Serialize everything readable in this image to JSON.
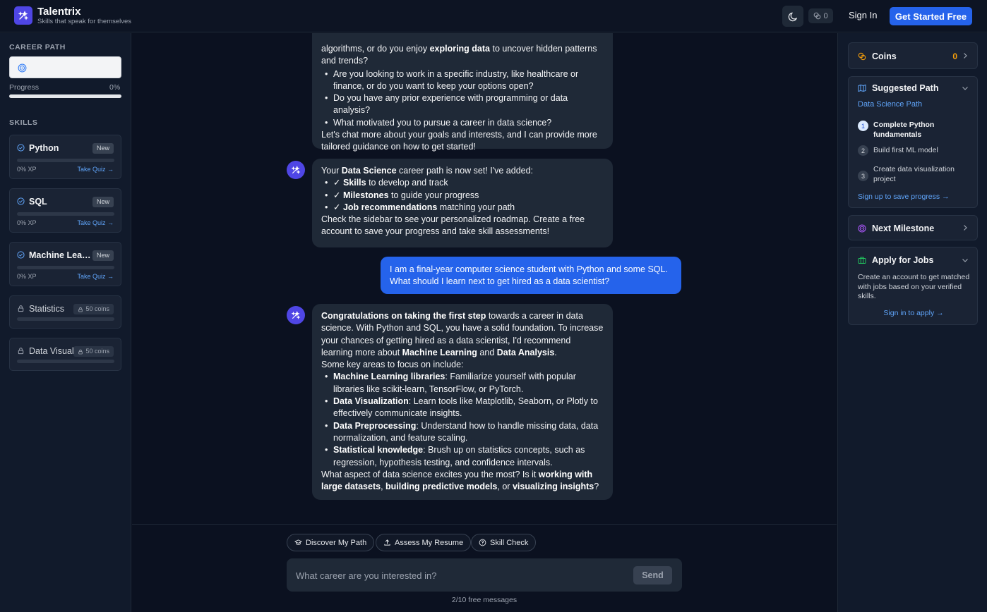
{
  "header": {
    "brand": "Talentrix",
    "tagline": "Skills that speak for themselves",
    "coin_count": "0",
    "signin_label": "Sign In",
    "get_started_label": "Get Started Free"
  },
  "left": {
    "career_path_label": "CAREER PATH",
    "progress_label": "Progress",
    "progress_value": "0%",
    "progress_fraction": 0.0,
    "skills_label": "SKILLS",
    "skills": [
      {
        "name": "Python",
        "badge": "New",
        "xp": "0% XP",
        "quiz": "Take Quiz →",
        "progress": 0.0
      },
      {
        "name": "SQL",
        "badge": "New",
        "xp": "0% XP",
        "quiz": "Take Quiz →",
        "progress": 0.0
      },
      {
        "name": "Machine Learning",
        "badge": "New",
        "xp": "0% XP",
        "quiz": "Take Quiz →",
        "progress": 0.0
      }
    ],
    "locked_skills": [
      {
        "name": "Statistics",
        "badge": "50 coins"
      },
      {
        "name": "Data Visualization",
        "badge": "50 coins"
      }
    ]
  },
  "chat": {
    "msg1": {
      "lead1": "algorithms, or do you enjoy ",
      "lead_bold": "exploring data",
      "lead2": " to uncover hidden patterns",
      "lead3": "and trends?",
      "bullets": [
        "Are you looking to work in a specific industry, like healthcare or finance, or do you want to keep your options open?",
        "Do you have any prior experience with programming or data analysis?",
        "What motivated you to pursue a career in data science?"
      ],
      "closing": "Let's chat more about your goals and interests, and I can provide more tailored guidance on how to get started!"
    },
    "msg2": {
      "intro_a": "Your ",
      "intro_bold": "Data Science",
      "intro_b": " career path is now set! I've added:",
      "items": [
        {
          "bold": "✓ Skills",
          "rest": " to develop and track"
        },
        {
          "bold": "✓ Milestones",
          "rest": " to guide your progress"
        },
        {
          "bold": "✓ Job recommendations",
          "rest": " matching your path"
        }
      ],
      "closing": "Check the sidebar to see your personalized roadmap. Create a free account to save your progress and take skill assessments!"
    },
    "user_msg": "I am a final-year computer science student with Python and some SQL. What should I learn next to get hired as a data scientist?",
    "msg3": {
      "p1_bold": "Congratulations on taking the first step",
      "p1_a": " towards a career in data science. With Python and SQL, you have a solid foundation. To increase your chances of getting hired as a data scientist, I'd recommend learning more about ",
      "p1_bold2": "Machine Learning",
      "p1_and": " and ",
      "p1_bold3": "Data Analysis",
      "p1_end": ".",
      "p2": "Some key areas to focus on include:",
      "bullets": [
        {
          "bold": "Machine Learning libraries",
          "rest": ": Familiarize yourself with popular libraries like scikit-learn, TensorFlow, or PyTorch."
        },
        {
          "bold": "Data Visualization",
          "rest": ": Learn tools like Matplotlib, Seaborn, or Plotly to effectively communicate insights."
        },
        {
          "bold": "Data Preprocessing",
          "rest": ": Understand how to handle missing data, data normalization, and feature scaling."
        },
        {
          "bold": "Statistical knowledge",
          "rest": ": Brush up on statistics concepts, such as regression, hypothesis testing, and confidence intervals."
        }
      ],
      "q_a": "What aspect of data science excites you the most? Is it ",
      "q_b1": "working with large datasets",
      "q_c": ", ",
      "q_b2": "building predictive models",
      "q_d": ", or ",
      "q_b3": "visualizing insights",
      "q_e": "?"
    }
  },
  "composer": {
    "chips": [
      "Discover My Path",
      "Assess My Resume",
      "Skill Check"
    ],
    "placeholder": "What career are you interested in?",
    "send_label": "Send",
    "free_messages": "2/10 free messages"
  },
  "right": {
    "coins_label": "Coins",
    "coins_value": "0",
    "suggested_label": "Suggested Path",
    "path_name": "Data Science Path",
    "steps": [
      {
        "num": "1",
        "text": "Complete Python fundamentals"
      },
      {
        "num": "2",
        "text": "Build first ML model"
      },
      {
        "num": "3",
        "text": "Create data visualization project"
      }
    ],
    "signup_link": "Sign up to save progress →",
    "milestone_label": "Next Milestone",
    "jobs_label": "Apply for Jobs",
    "jobs_desc": "Create an account to get matched with jobs based on your verified skills.",
    "jobs_link": "Sign in to apply →"
  },
  "colors": {
    "accent": "#2563eb",
    "brand": "#4f46e5",
    "coin": "#f59e0b",
    "link": "#60a5fa"
  }
}
